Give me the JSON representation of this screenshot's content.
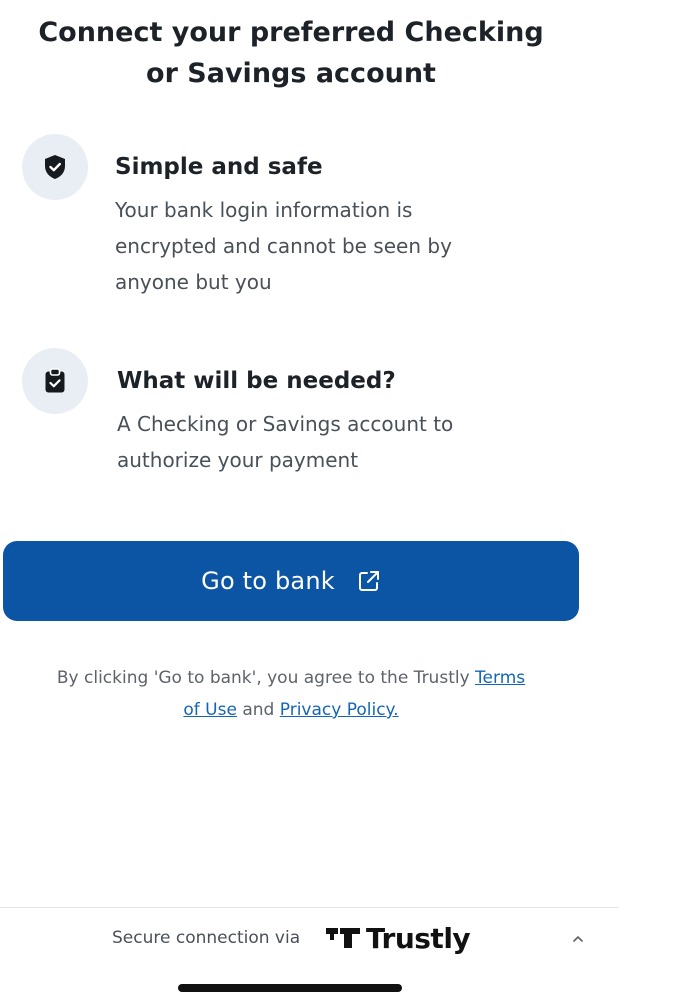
{
  "header": {
    "title_line1": "Connect your preferred Checking",
    "title_line2": "or Savings account"
  },
  "features": [
    {
      "icon": "shield-check-icon",
      "heading": "Simple and safe",
      "description_lines": [
        "Your bank login information is",
        "encrypted and cannot be seen by",
        "anyone but you"
      ]
    },
    {
      "icon": "clipboard-icon",
      "heading": "What will be needed?",
      "description_lines": [
        "A Checking or Savings account to",
        "authorize your payment"
      ]
    }
  ],
  "cta": {
    "label": "Go to bank",
    "icon": "external-link-icon",
    "color": "#0b55a4"
  },
  "legal": {
    "prefix": "By clicking 'Go to bank', you agree to the Trustly ",
    "terms_link_part1": "Terms",
    "terms_link_part2": "of Use",
    "conjunction": " and ",
    "privacy_link": "Privacy Policy."
  },
  "footer": {
    "secure_text": "Secure connection via",
    "brand_name": "Trustly",
    "brand_icon": "trustly-logo-icon",
    "expand_icon": "chevron-up-icon"
  },
  "colors": {
    "primary": "#0b55a4",
    "link": "#1466b5",
    "icon_circle": "#e9eef5"
  }
}
